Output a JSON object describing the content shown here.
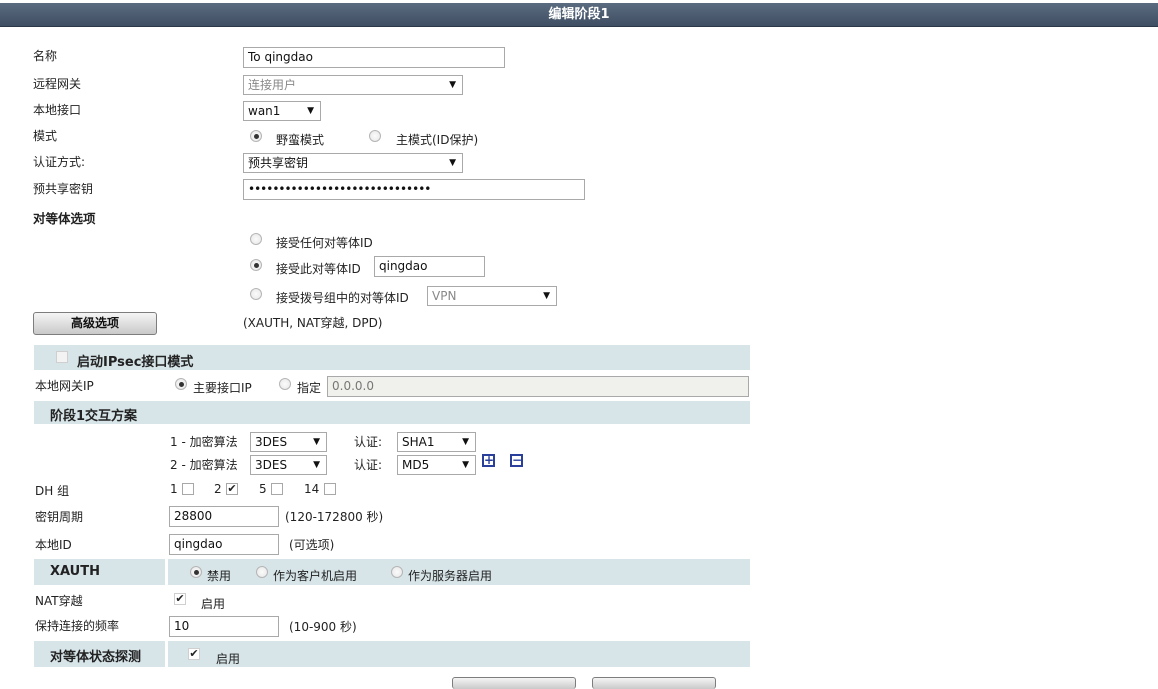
{
  "window": {
    "title": "编辑阶段1"
  },
  "basic": {
    "name_label": "名称",
    "name_value": "To qingdao",
    "remote_gw_label": "远程网关",
    "remote_gw_value": "连接用户",
    "local_if_label": "本地接口",
    "local_if_value": "wan1",
    "mode_label": "模式",
    "mode_aggressive": "野蛮模式",
    "mode_main": "主模式(ID保护)",
    "auth_label": "认证方式:",
    "auth_value": "预共享密钥",
    "psk_label": "预共享密钥",
    "psk_value": "••••••••••••••••••••••••••••••"
  },
  "peer": {
    "title": "对等体选项",
    "accept_any": "接受任何对等体ID",
    "accept_this": "接受此对等体ID",
    "accept_this_value": "qingdao",
    "accept_dialup": "接受拨号组中的对等体ID",
    "dialup_value": "VPN"
  },
  "advanced": {
    "button": "高级选项",
    "hint": "(XAUTH, NAT穿越, DPD)",
    "ipsec_mode_label": "启动IPsec接口模式",
    "local_gw_label": "本地网关IP",
    "local_gw_primary": "主要接口IP",
    "local_gw_specify": "指定",
    "local_gw_value": "0.0.0.0",
    "proposal_title": "阶段1交互方案",
    "proposals": [
      {
        "label": "1 - 加密算法",
        "enc": "3DES",
        "auth_label": "认证:",
        "auth": "SHA1"
      },
      {
        "label": "2 - 加密算法",
        "enc": "3DES",
        "auth_label": "认证:",
        "auth": "MD5"
      }
    ],
    "dh_label": "DH 组",
    "dh_groups": [
      {
        "num": "1",
        "checked": false
      },
      {
        "num": "2",
        "checked": true
      },
      {
        "num": "5",
        "checked": false
      },
      {
        "num": "14",
        "checked": false
      }
    ],
    "keylife_label": "密钥周期",
    "keylife_value": "28800",
    "keylife_hint": "(120-172800 秒)",
    "localid_label": "本地ID",
    "localid_value": "qingdao",
    "localid_hint": "(可选项)",
    "xauth_label": "XAUTH",
    "xauth_disable": "禁用",
    "xauth_client": "作为客户机启用",
    "xauth_server": "作为服务器启用",
    "nat_label": "NAT穿越",
    "nat_enable": "启用",
    "keepalive_label": "保持连接的频率",
    "keepalive_value": "10",
    "keepalive_hint": "(10-900 秒)",
    "dpd_label": "对等体状态探测",
    "dpd_enable": "启用"
  },
  "icons": {
    "add": "plus-box-icon",
    "remove": "minus-box-icon",
    "check": "✔"
  }
}
